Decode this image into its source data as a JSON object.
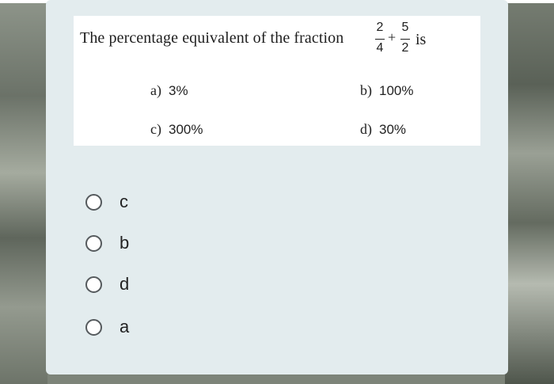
{
  "question": {
    "text": "The percentage equivalent of the fraction",
    "fraction1": {
      "numerator": "2",
      "denominator": "4"
    },
    "operator": "+",
    "fraction2": {
      "numerator": "5",
      "denominator": "2"
    },
    "suffix": "is",
    "options": [
      {
        "letter": "a)",
        "value": "3%"
      },
      {
        "letter": "b)",
        "value": "100%"
      },
      {
        "letter": "c)",
        "value": "300%"
      },
      {
        "letter": "d)",
        "value": "30%"
      }
    ]
  },
  "answers": [
    {
      "label": "c",
      "selected": false
    },
    {
      "label": "b",
      "selected": false
    },
    {
      "label": "d",
      "selected": false
    },
    {
      "label": "a",
      "selected": false
    }
  ]
}
